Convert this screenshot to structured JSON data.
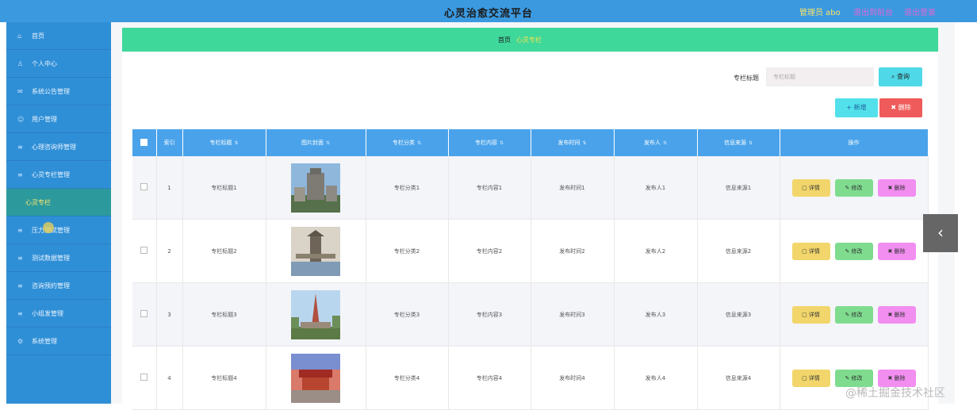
{
  "header": {
    "title": "心灵治愈交流平台",
    "user_label": "管理员 abo",
    "link1": "退出到前台",
    "link2": "退出登录"
  },
  "sidebar": {
    "items": [
      {
        "label": "首页",
        "icon": "home-icon"
      },
      {
        "label": "个人中心",
        "icon": "person-icon"
      },
      {
        "label": "系统公告管理",
        "icon": "notice-icon"
      },
      {
        "label": "用户管理",
        "icon": "user-icon"
      },
      {
        "label": "心理咨询师管理",
        "icon": "list-icon"
      },
      {
        "label": "心灵专栏管理",
        "icon": "list-icon"
      },
      {
        "label": "心灵专栏",
        "icon": "",
        "sub": true
      },
      {
        "label": "压力测试管理",
        "icon": "list-icon"
      },
      {
        "label": "测试数据管理",
        "icon": "list-icon"
      },
      {
        "label": "咨询预约管理",
        "icon": "list-icon"
      },
      {
        "label": "小组发管理",
        "icon": "list-icon"
      },
      {
        "label": "系统管理",
        "icon": "gear-icon"
      }
    ]
  },
  "breadcrumb": {
    "home": "首页",
    "current": "心灵专栏"
  },
  "search": {
    "label": "专栏标题",
    "placeholder": "专栏标题",
    "button": "查询"
  },
  "actions": {
    "add": "新增",
    "delete": "删除"
  },
  "table": {
    "headers": [
      "",
      "索引",
      "专栏标题",
      "图片封面",
      "专栏分类",
      "专栏内容",
      "发布时间",
      "发布人",
      "信息来源",
      "操作"
    ],
    "row_buttons": {
      "detail": "详情",
      "edit": "修改",
      "remove": "删除"
    },
    "rows": [
      {
        "index": "1",
        "title": "专栏标题1",
        "category": "专栏分类1",
        "content": "专栏内容1",
        "time": "发布时间1",
        "author": "发布人1",
        "source": "信息来源1"
      },
      {
        "index": "2",
        "title": "专栏标题2",
        "category": "专栏分类2",
        "content": "专栏内容2",
        "time": "发布时间2",
        "author": "发布人2",
        "source": "信息来源2"
      },
      {
        "index": "3",
        "title": "专栏标题3",
        "category": "专栏分类3",
        "content": "专栏内容3",
        "time": "发布时间3",
        "author": "发布人3",
        "source": "信息来源3"
      },
      {
        "index": "4",
        "title": "专栏标题4",
        "category": "专栏分类4",
        "content": "专栏内容4",
        "time": "发布时间4",
        "author": "发布人4",
        "source": "信息来源4"
      }
    ]
  },
  "watermark": "@稀土掘金技术社区",
  "colors": {
    "topbar": "#3b99e0",
    "sidebar": "#2f8fd6",
    "breadcrumb": "#3fd89b",
    "table_header": "#4aa3ea"
  }
}
